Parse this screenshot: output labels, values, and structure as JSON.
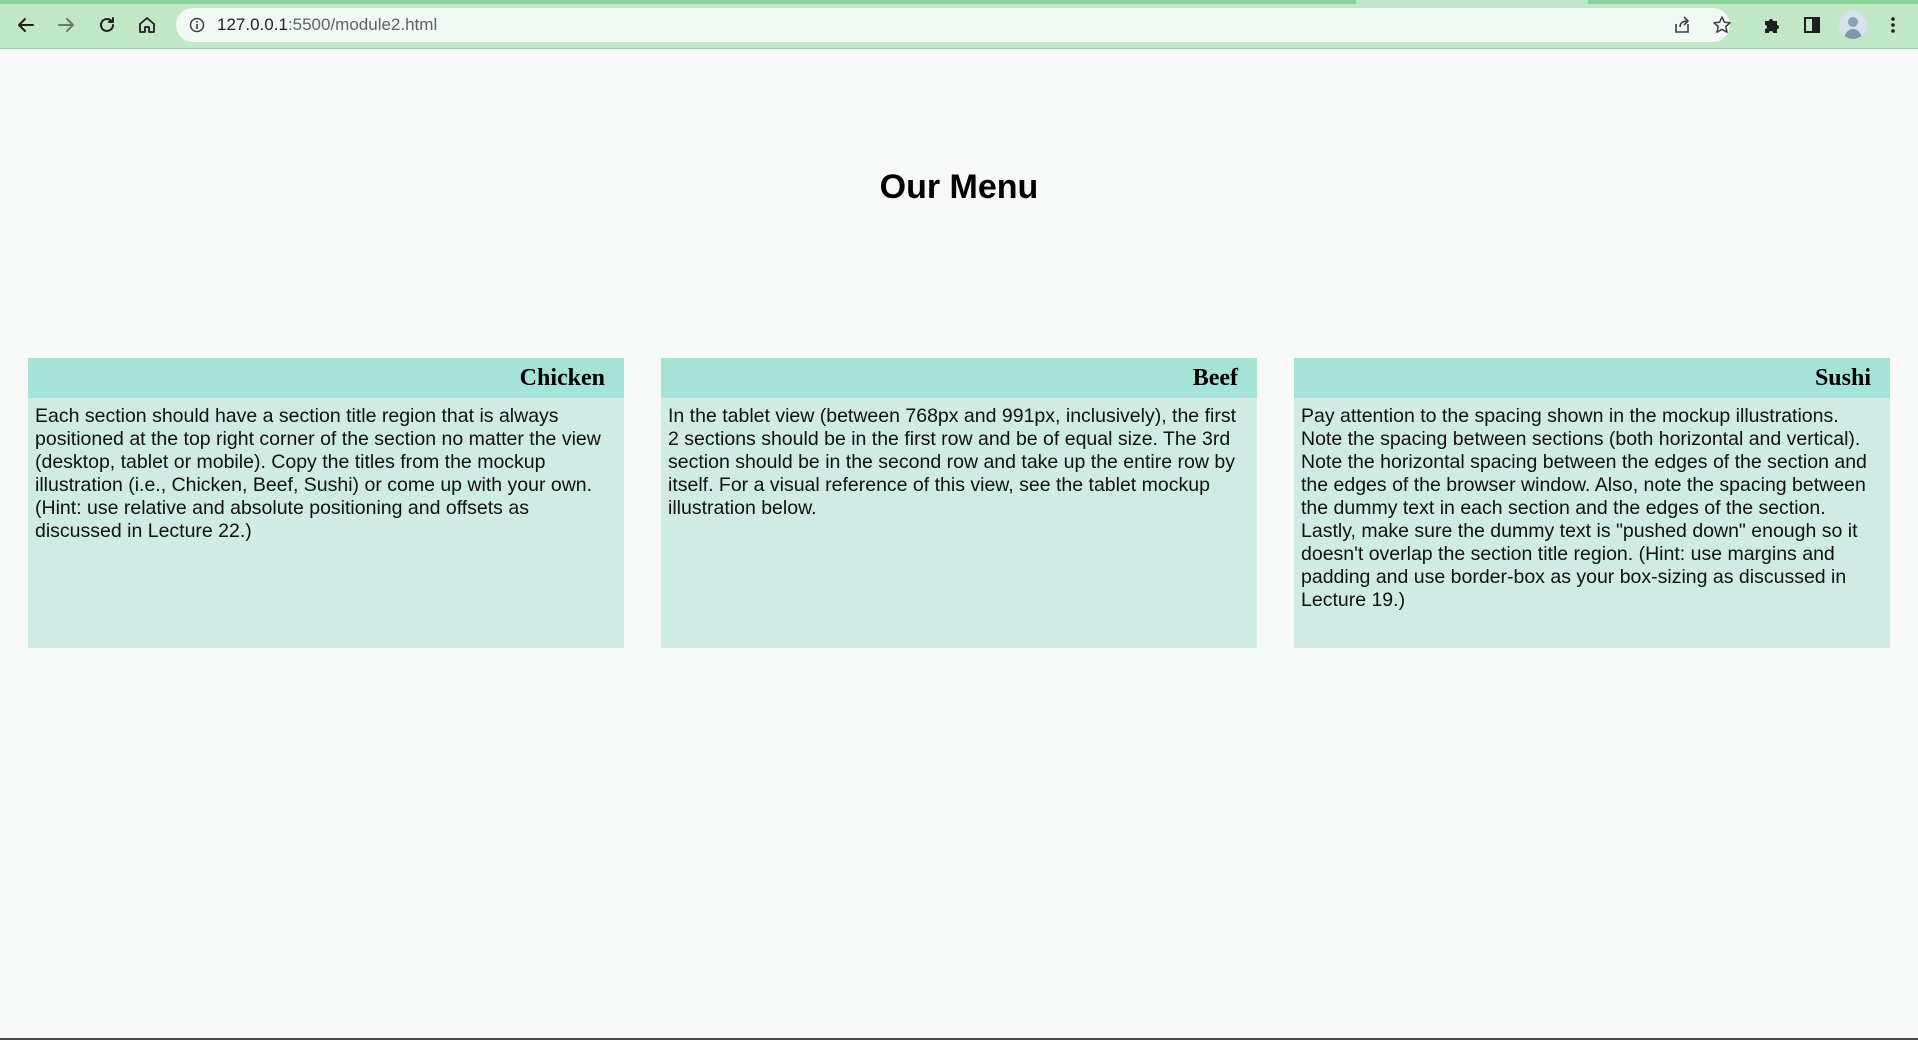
{
  "browser": {
    "url_host": "127.0.0.1",
    "url_path": ":5500/module2.html"
  },
  "page": {
    "title": "Our Menu"
  },
  "sections": [
    {
      "title": "Chicken",
      "text": "Each section should have a section title region that is always positioned at the top right corner of the section no matter the view (desktop, tablet or mobile). Copy the titles from the mockup illustration (i.e., Chicken, Beef, Sushi) or come up with your own. (Hint: use relative and absolute positioning and offsets as discussed in Lecture 22.)"
    },
    {
      "title": "Beef",
      "text": "In the tablet view (between 768px and 991px, inclusively), the first 2 sections should be in the first row and be of equal size. The 3rd section should be in the second row and take up the entire row by itself. For a visual reference of this view, see the tablet mockup illustration below."
    },
    {
      "title": "Sushi",
      "text": "Pay attention to the spacing shown in the mockup illustrations. Note the spacing between sections (both horizontal and vertical). Note the horizontal spacing between the edges of the section and the edges of the browser window. Also, note the spacing between the dummy text in each section and the edges of the section. Lastly, make sure the dummy text is \"pushed down\" enough so it doesn't overlap the section title region. (Hint: use margins and padding and use border-box as your box-sizing as discussed in Lecture 19.)"
    }
  ],
  "colors": {
    "page_background": "#f7f9f8",
    "toolbar": "#c2e7c7",
    "section_body": "#cfebe4",
    "section_title": "#a5e3d6"
  },
  "icons": {
    "back": "arrow-left-icon",
    "forward": "arrow-right-icon",
    "reload": "reload-icon",
    "home": "home-icon",
    "site_info": "info-icon",
    "share": "share-icon",
    "bookmark": "star-icon",
    "extensions": "puzzle-icon",
    "side_panel": "side-panel-icon",
    "profile": "avatar",
    "menu": "kebab-menu-icon"
  }
}
